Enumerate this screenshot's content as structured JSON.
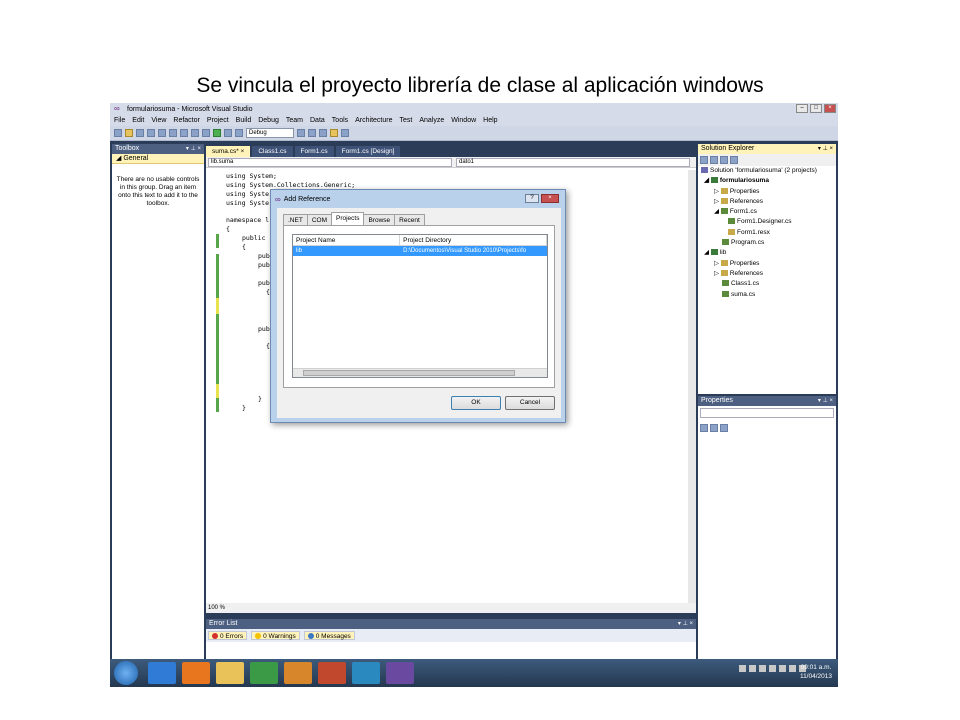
{
  "caption": "Se vincula el proyecto librería de clase al aplicación windows",
  "window": {
    "title": "formulariosuma - Microsoft Visual Studio",
    "menu": [
      "File",
      "Edit",
      "View",
      "Refactor",
      "Project",
      "Build",
      "Debug",
      "Team",
      "Data",
      "Tools",
      "Architecture",
      "Test",
      "Analyze",
      "Window",
      "Help"
    ],
    "config": "Debug"
  },
  "toolbox": {
    "title": "Toolbox",
    "group": "General",
    "message": "There are no usable controls in this group. Drag an item onto this text to add it to the toolbox."
  },
  "editor": {
    "tabs": [
      "suma.cs*",
      "Class1.cs",
      "Form1.cs",
      "Form1.cs [Design]"
    ],
    "nav_left": "lib.suma",
    "nav_right": "dato1",
    "lines": [
      "using System;",
      "using System.Collections.Generic;",
      "using Syste",
      "using Syste",
      "namespace l",
      "{",
      "public",
      "{",
      "pub",
      "pub",
      "pub",
      "{",
      "pub",
      "{",
      "}",
      "}"
    ],
    "zoom": "100 %"
  },
  "error_list": {
    "title": "Error List",
    "errors": "0 Errors",
    "warnings": "0 Warnings",
    "messages": "0 Messages"
  },
  "solution_explorer": {
    "title": "Solution Explorer",
    "items": [
      "Solution 'formulariosuma' (2 projects)",
      "formulariosuma",
      "Properties",
      "References",
      "Form1.cs",
      "Form1.Designer.cs",
      "Form1.resx",
      "Program.cs",
      "lib",
      "Properties",
      "References",
      "Class1.cs",
      "suma.cs"
    ]
  },
  "properties": {
    "title": "Properties"
  },
  "dialog": {
    "title": "Add Reference",
    "tabs": [
      ".NET",
      "COM",
      "Projects",
      "Browse",
      "Recent"
    ],
    "columns": [
      "Project Name",
      "Project Directory"
    ],
    "row": {
      "name": "lib",
      "directory": "D:\\Documentos\\Visual Studio 2010\\Projects\\fo"
    },
    "ok": "OK",
    "cancel": "Cancel"
  },
  "taskbar": {
    "time": "09:01 a.m.",
    "date": "11/04/2013"
  }
}
